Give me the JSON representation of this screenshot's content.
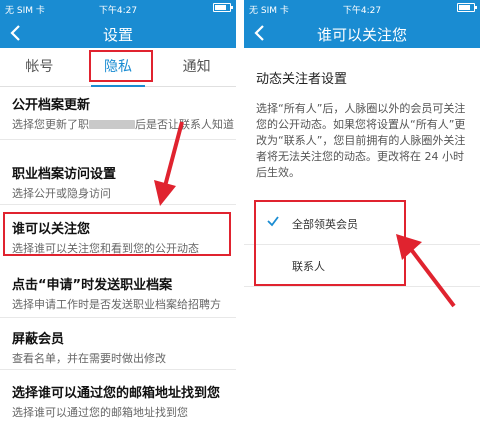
{
  "left_screen": {
    "status": {
      "carrier": "无 SIM 卡",
      "time": "下午4:27",
      "battery_icon": "battery-icon"
    },
    "nav_title": "设置",
    "tabs": [
      {
        "label": "帐号"
      },
      {
        "label": "隐私"
      },
      {
        "label": "通知"
      }
    ],
    "active_tab": "隐私",
    "items": [
      {
        "title": "公开档案更新",
        "subtitle_a": "选择您更新了职",
        "subtitle_b": "后是否让联系人知道"
      },
      {
        "title": "职业档案访问设置",
        "subtitle": "选择公开或隐身访问"
      },
      {
        "title": "谁可以关注您",
        "subtitle": "选择谁可以关注您和看到您的公开动态"
      },
      {
        "title": "点击“申请”时发送职业档案",
        "subtitle": "选择申请工作时是否发送职业档案给招聘方"
      },
      {
        "title": "屏蔽会员",
        "subtitle": "查看名单，并在需要时做出修改"
      },
      {
        "title": "选择谁可以通过您的邮箱地址找到您",
        "subtitle": "选择谁可以通过您的邮箱地址找到您"
      }
    ]
  },
  "right_screen": {
    "status": {
      "carrier": "无 SIM 卡",
      "time": "下午4:27"
    },
    "nav_title": "谁可以关注您",
    "section_title": "动态关注者设置",
    "description": "选择“所有人”后，人脉圈以外的会员可关注您的公开动态。如果您将设置从“所有人”更改为“联系人”，您目前拥有的人脉圈外关注者将无法关注您的动态。更改将在 24 小时后生效。",
    "options": [
      {
        "label": "全部领英会员",
        "selected": true
      },
      {
        "label": "联系人",
        "selected": false
      }
    ]
  },
  "colors": {
    "brand_blue": "#1a8cd2",
    "highlight_red": "#e0232f"
  }
}
